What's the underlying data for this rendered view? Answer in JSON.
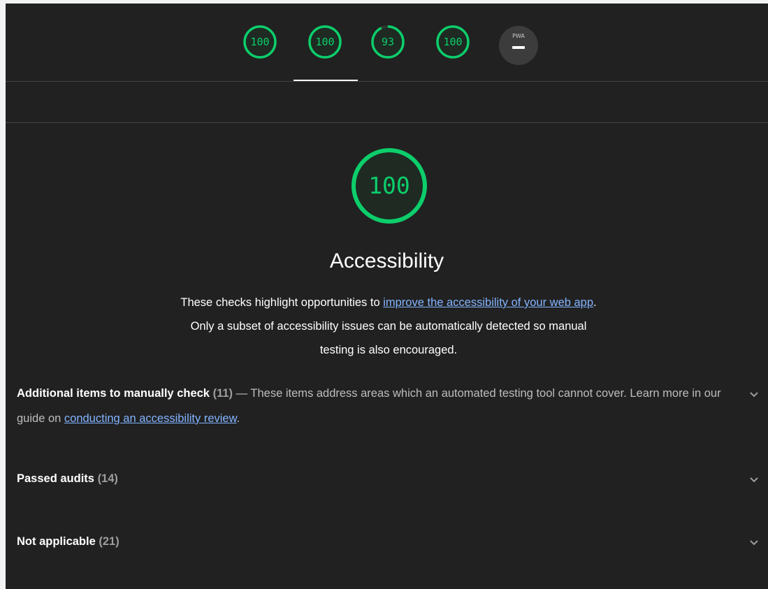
{
  "gauges": [
    {
      "label": "100",
      "score": 100
    },
    {
      "label": "100",
      "score": 100
    },
    {
      "label": "93",
      "score": 93
    },
    {
      "label": "100",
      "score": 100
    }
  ],
  "pwa": {
    "label": "PWA"
  },
  "category": {
    "score_label": "100",
    "score": 100,
    "title": "Accessibility",
    "desc_before": "These checks highlight opportunities to ",
    "desc_link": "improve the accessibility of your web app",
    "desc_after": ". Only a subset of accessibility issues can be automatically detected so manual testing is also encouraged."
  },
  "groups": {
    "manual": {
      "title": "Additional items to manually check",
      "count": "(11)",
      "desc_before": "— These items address areas which an automated testing tool cannot cover. Learn more in our guide on ",
      "link": "conducting an accessibility review",
      "desc_after": "."
    },
    "passed": {
      "title": "Passed audits",
      "count": "(14)"
    },
    "notapplicable": {
      "title": "Not applicable",
      "count": "(21)"
    }
  },
  "colors": {
    "pass": "#0cce6b",
    "background": "#212121",
    "link": "#82b4ff"
  }
}
